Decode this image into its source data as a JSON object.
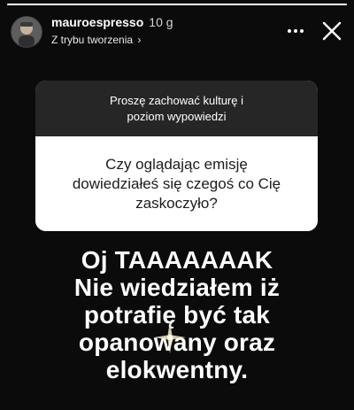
{
  "story": {
    "progress_fraction": 1.0
  },
  "header": {
    "username": "mauroespresso",
    "time": "10 g",
    "subtitle": "Z trybu tworzenia",
    "subtitle_chevron": "›",
    "more_icon": "more-horizontal-icon",
    "close_icon": "close-icon"
  },
  "question_card": {
    "prompt_lines": [
      "Proszę zachować kulturę i",
      "poziom wypowiedzi"
    ],
    "question_lines": [
      "Czy oglądając emisję",
      "dowiedziałeś się czegoś co Cię",
      "zaskoczyło?"
    ]
  },
  "answer": {
    "lines": [
      "Oj TAAAAAAAK",
      "Nie wiedziałem iż",
      "potrafię być tak",
      "opanowany oraz",
      "elokwentny."
    ]
  },
  "colors": {
    "background": "#0b0b0b",
    "card_top": "#262626",
    "card_body": "#ffffff",
    "text_primary": "#ffffff"
  }
}
